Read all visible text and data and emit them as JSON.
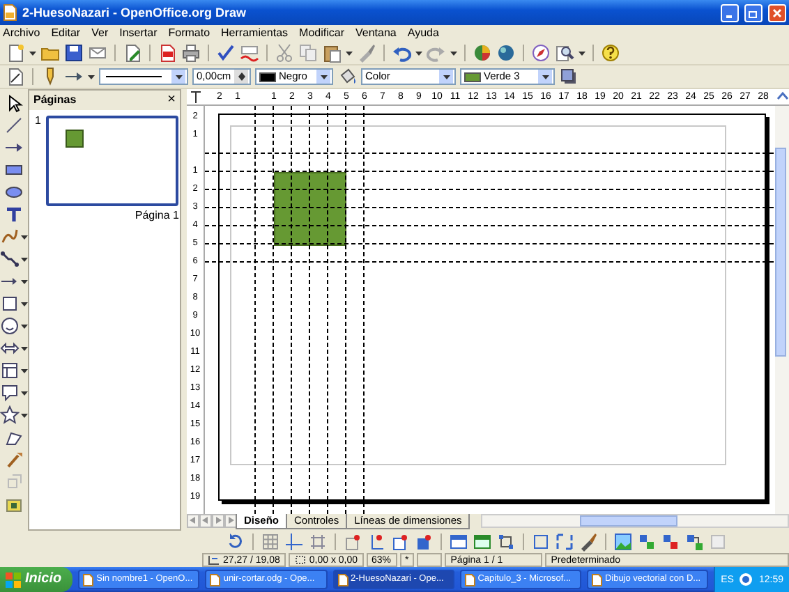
{
  "window": {
    "title": "2-HuesoNazari - OpenOffice.org Draw"
  },
  "menu": [
    "Archivo",
    "Editar",
    "Ver",
    "Insertar",
    "Formato",
    "Herramientas",
    "Modificar",
    "Ventana",
    "Ayuda"
  ],
  "line_and_filling": {
    "line_width": "0,00cm",
    "line_color": "Negro",
    "area_style": "Color",
    "area_color": "Verde 3"
  },
  "pages_panel": {
    "title": "Páginas",
    "close": "×",
    "pages": [
      {
        "number": "1",
        "label": "Página 1",
        "selected": true
      }
    ]
  },
  "rulers": {
    "horizontal": {
      "negative": [
        "2",
        "1"
      ],
      "positive": [
        "1",
        "2",
        "3",
        "4",
        "5",
        "6",
        "7",
        "8",
        "9",
        "10",
        "11",
        "12",
        "13",
        "14",
        "15",
        "16",
        "17",
        "18",
        "19",
        "20",
        "21",
        "22",
        "23",
        "24",
        "25",
        "26",
        "27",
        "28"
      ]
    },
    "vertical": {
      "negative": [
        "2",
        "1"
      ],
      "positive": [
        "1",
        "2",
        "3",
        "4",
        "5",
        "6",
        "7",
        "8",
        "9",
        "10",
        "11",
        "12",
        "13",
        "14",
        "15",
        "16",
        "17",
        "18",
        "19"
      ]
    }
  },
  "tabs": [
    {
      "label": "Diseño",
      "selected": true
    },
    {
      "label": "Controles",
      "selected": false
    },
    {
      "label": "Líneas de dimensiones",
      "selected": false
    }
  ],
  "status_bar": {
    "position": "27,27 / 19,08",
    "size": "0,00 x 0,00",
    "zoom": "63%",
    "modified": "*",
    "page": "Página 1 / 1",
    "layout": "Predeterminado"
  },
  "taskbar": {
    "start": "Inicio",
    "tasks": [
      {
        "label": "Sin nombre1 - OpenO...",
        "selected": false
      },
      {
        "label": "unir-cortar.odg - Ope...",
        "selected": false
      },
      {
        "label": "2-HuesoNazari - Ope...",
        "selected": true
      },
      {
        "label": "Capitulo_3 - Microsof...",
        "selected": false
      },
      {
        "label": "Dibujo vectorial con D...",
        "selected": false
      }
    ],
    "language": "ES",
    "clock": "12:59"
  }
}
